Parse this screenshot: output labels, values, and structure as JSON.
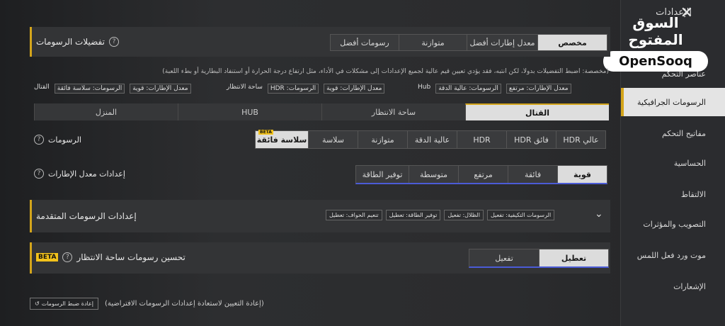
{
  "sidebar": {
    "title": "الإعدادات",
    "items": [
      {
        "label": "عناصر التحكم"
      },
      {
        "label": "الرسومات الجرافيكية"
      },
      {
        "label": "مفاتيح التحكم"
      },
      {
        "label": "الحساسية"
      },
      {
        "label": "الالتقاط"
      },
      {
        "label": "التصويب والمؤثرات"
      },
      {
        "label": "موت ورد فعل اللمس"
      },
      {
        "label": "الإشعارات"
      }
    ]
  },
  "logo": {
    "arabic": "السوق المفتوح",
    "english": "OpenSooq"
  },
  "preferences": {
    "title": "تفضيلات الرسومات",
    "options": [
      "مخصص",
      "معدل إطارات أفضل",
      "متوازنة",
      "رسومات أفضل"
    ],
    "selected": "مخصص",
    "note": "(مخصصة: اضبط التفضيلات بدولا، لكن انتبه، فقد يؤدي تعيين قيم عالية لجميع الإعدادات إلى مشكلات في الأداء، مثل ارتفاع درجة الحرارة أو استنفاد البطارية أو بطء اللعبة)",
    "presets": [
      {
        "a": "معدل الإطارات: مرتفع",
        "b": "الرسومات: عالية الدقة",
        "c": "Hub"
      },
      {
        "a": "معدل الإطارات: قوية",
        "b": "الرسومات: HDR",
        "c": "ساحة الانتظار"
      },
      {
        "a": "معدل الإطارات: قوية",
        "b": "الرسومات: سلاسة فائقة",
        "c": "القتال"
      }
    ]
  },
  "tabs": [
    "القتال",
    "ساحة الانتظار",
    "HUB",
    "المنزل"
  ],
  "graphics": {
    "label": "الرسومات",
    "options": [
      "عالي HDR",
      "فائق HDR",
      "HDR",
      "عالية الدقة",
      "متوازنة",
      "سلاسة",
      "سلاسة فائقة"
    ],
    "beta": "BETA"
  },
  "framerate": {
    "label": "إعدادات معدل الإطارات",
    "options": [
      "قوية",
      "فائقة",
      "مرتفع",
      "متوسطة",
      "توفير الطاقة"
    ]
  },
  "advanced": {
    "title": "إعدادات الرسومات المتقدمة",
    "chips": [
      "الرسومات التكيفية: تفعيل",
      "الظلال: تفعيل",
      "توفير الطاقة: تعطيل",
      "تنعيم الحواف: تعطيل"
    ]
  },
  "lobby": {
    "title": "تحسين رسومات ساحة الانتظار",
    "beta": "BETA",
    "options": [
      "تعطيل",
      "تفعيل"
    ]
  },
  "reset": {
    "button": "إعادة ضبط الرسومات",
    "note": "(إعادة التعيين لاستعادة إعدادات الرسومات الافتراضية)"
  },
  "icons": {
    "close": "close-icon",
    "help": "help-icon",
    "chevron": "chevron-down-icon",
    "reset": "reset-icon"
  },
  "colors": {
    "accent": "#d4a51b",
    "selected": "#dcdcdc",
    "beta": "#f2c21b"
  }
}
